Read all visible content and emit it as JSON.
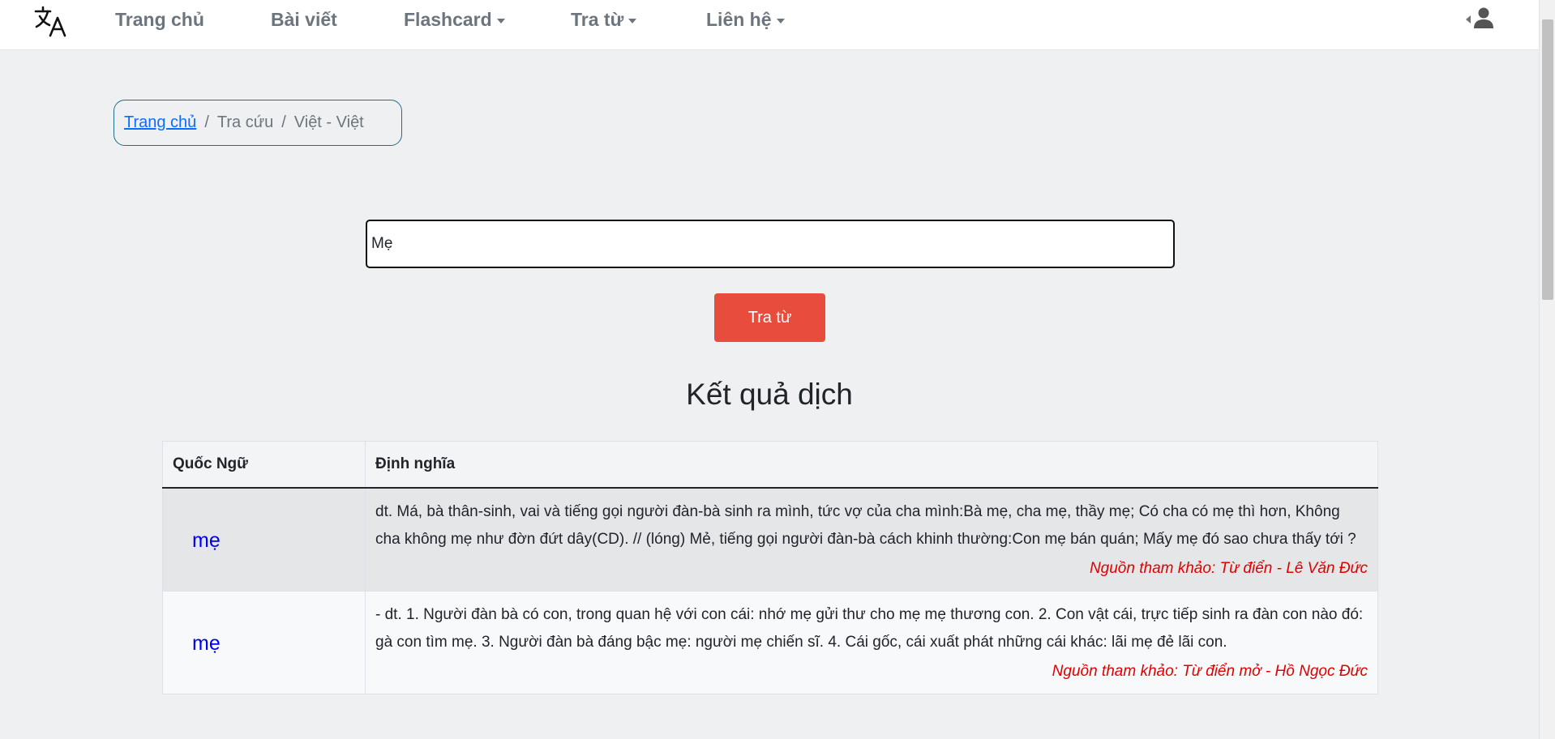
{
  "nav": {
    "logo_icon": "translate-icon",
    "items": [
      {
        "label": "Trang chủ",
        "dropdown": false
      },
      {
        "label": "Bài viết",
        "dropdown": false
      },
      {
        "label": "Flashcard",
        "dropdown": true
      },
      {
        "label": "Tra từ",
        "dropdown": true
      },
      {
        "label": "Liên hệ",
        "dropdown": true
      }
    ],
    "user_icon": "user-icon"
  },
  "breadcrumb": {
    "home": "Trang chủ",
    "items": [
      "Tra cứu",
      "Việt - Việt"
    ],
    "separator": "/"
  },
  "search": {
    "value": "Mẹ",
    "button_label": "Tra từ"
  },
  "results": {
    "title": "Kết quả dịch",
    "headers": [
      "Quốc Ngữ",
      "Định nghĩa"
    ],
    "rows": [
      {
        "word": "mẹ",
        "definition": "dt. Má, bà thân-sinh, vai và tiếng gọi người đàn-bà sinh ra mình, tức vợ của cha mình:Bà mẹ, cha mẹ, thầy mẹ; Có cha có mẹ thì hơn, Không cha không mẹ như đờn đứt dây(CD). // (lóng) Mẻ, tiếng gọi người đàn-bà cách khinh thường:Con mẹ bán quán; Mấy mẹ đó sao chưa thấy tới ?",
        "source": "Nguồn tham khảo: Từ điển - Lê Văn Đức"
      },
      {
        "word": "mẹ",
        "definition": "- dt. 1. Người đàn bà có con, trong quan hệ với con cái: nhớ mẹ gửi thư cho mẹ mẹ thương con. 2. Con vật cái, trực tiếp sinh ra đàn con nào đó: gà con tìm mẹ. 3. Người đàn bà đáng bậc mẹ: người mẹ chiến sĩ. 4. Cái gốc, cái xuất phát những cái khác: lãi mẹ đẻ lãi con.",
        "source": "Nguồn tham khảo: Từ điển mở - Hồ Ngọc Đức"
      }
    ]
  },
  "colors": {
    "button": "#e74c3c",
    "link": "#0d6efd",
    "word": "#0000ee",
    "source": "#e00000"
  }
}
